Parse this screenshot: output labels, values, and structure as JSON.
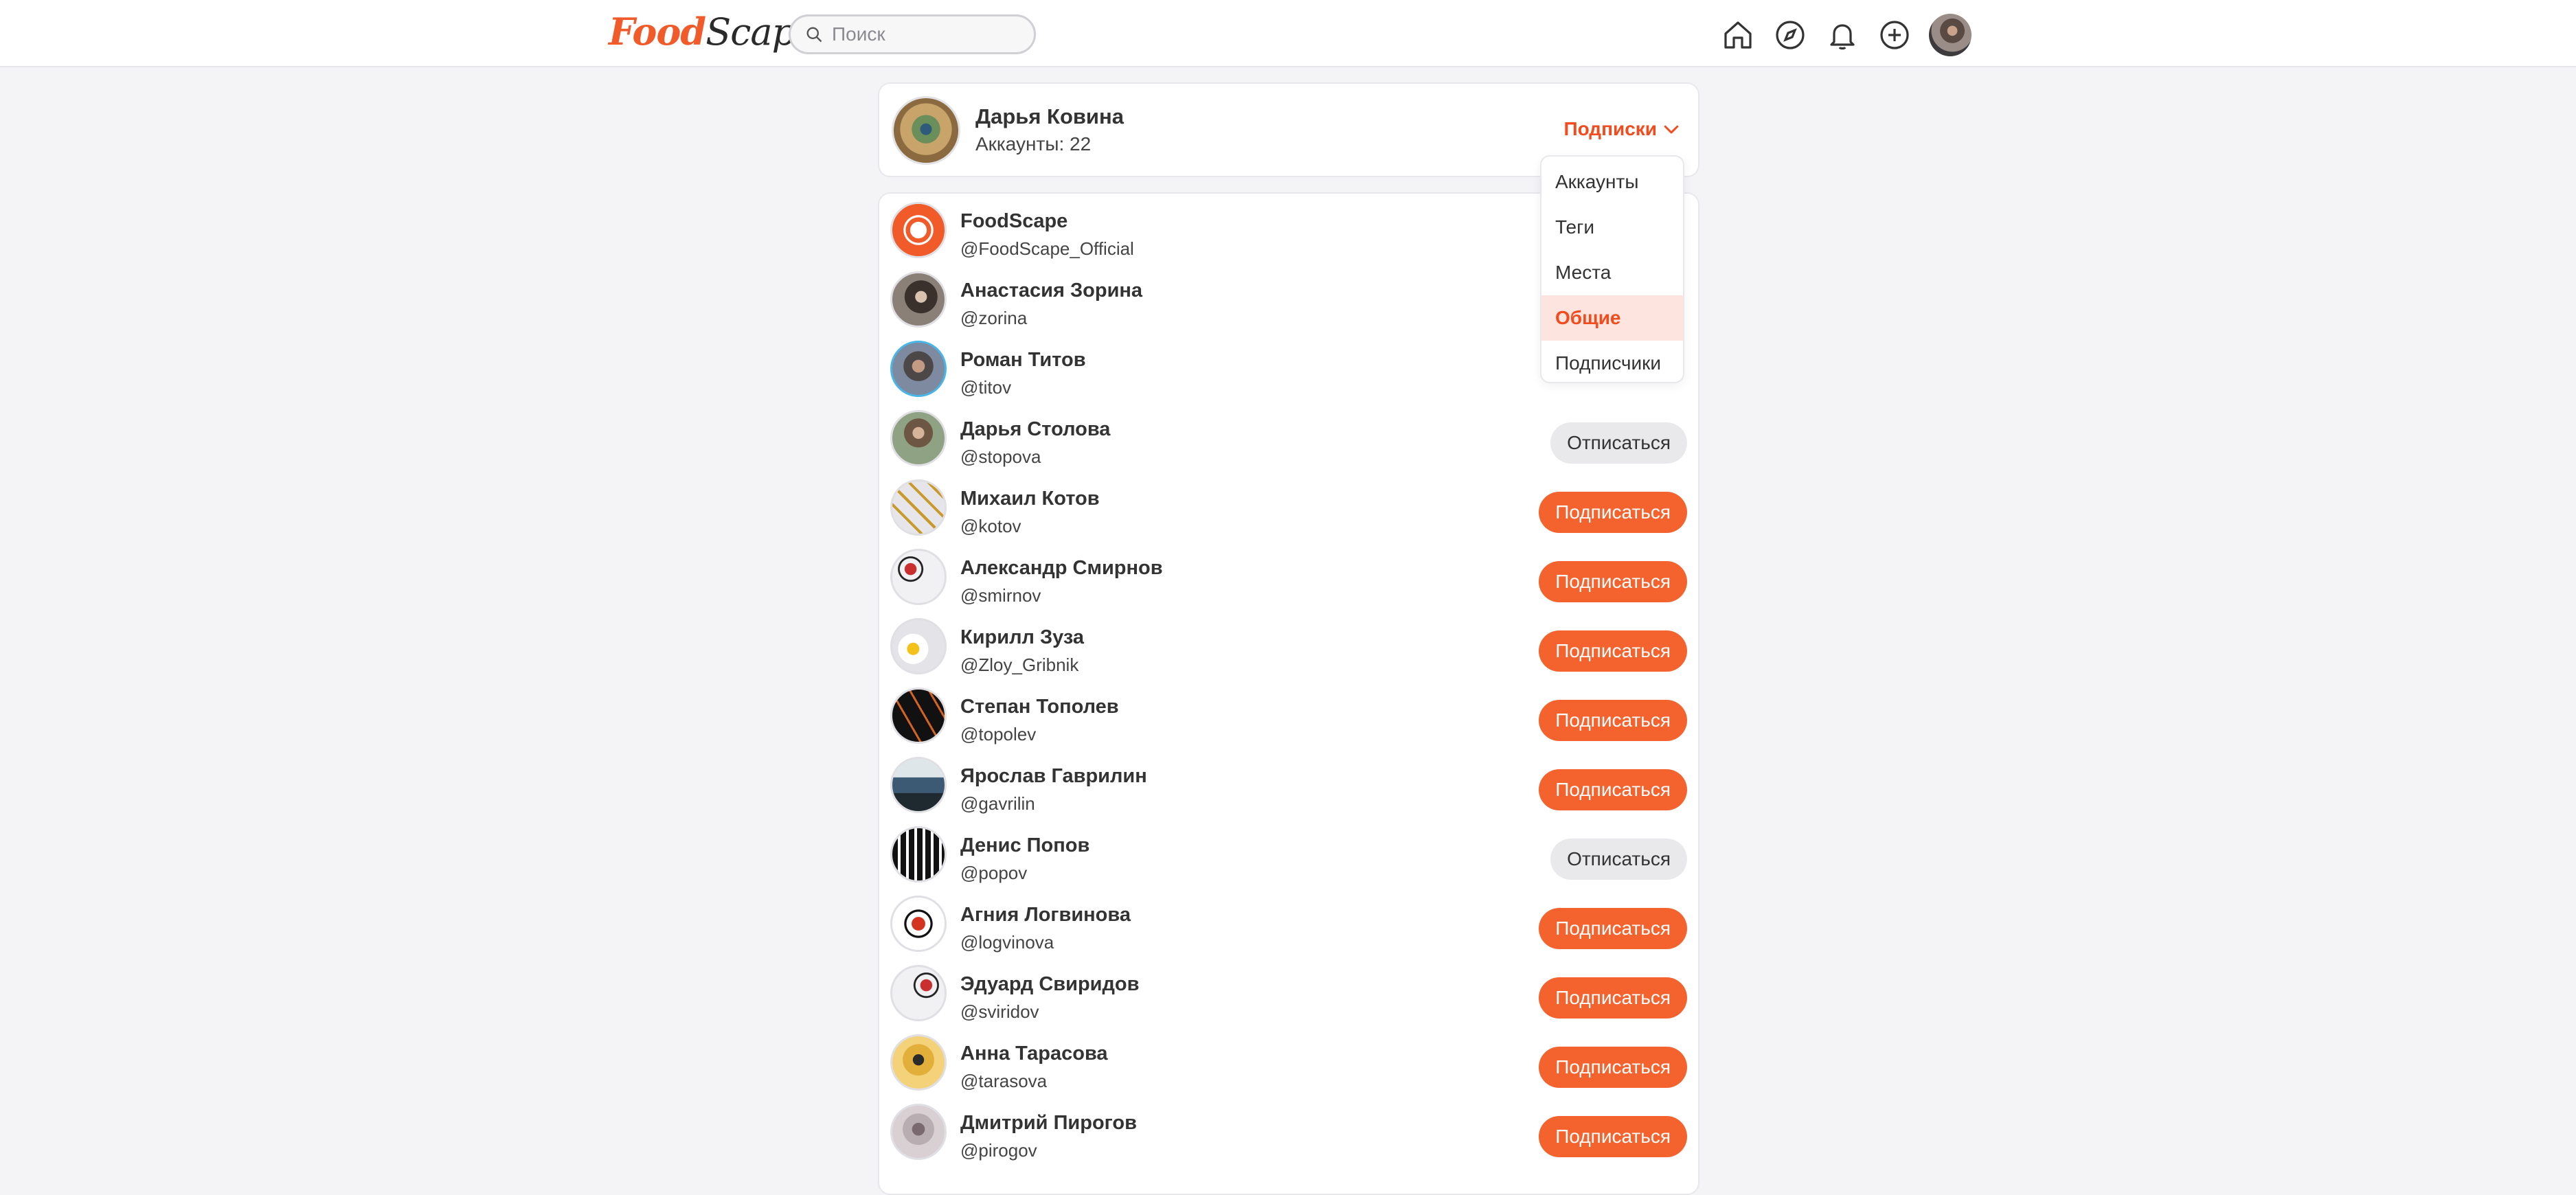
{
  "header": {
    "logo_food": "Food",
    "logo_scape": "Scape",
    "search_placeholder": "Поиск"
  },
  "profile": {
    "name": "Дарья Ковина",
    "accounts_count": "Аккаунты: 22",
    "filter_label": "Подписки"
  },
  "dropdown": {
    "items": [
      "Аккаунты",
      "Теги",
      "Места",
      "Общие",
      "Подписчики"
    ],
    "active": "Общие"
  },
  "accounts": [
    {
      "name": "FoodScape",
      "handle": "@FoodScape_Official",
      "button": ""
    },
    {
      "name": "Анастасия Зорина",
      "handle": "@zorina",
      "button": ""
    },
    {
      "name": "Роман Титов",
      "handle": "@titov",
      "button": ""
    },
    {
      "name": "Дарья Столова",
      "handle": "@stopova",
      "button": "Отписаться"
    },
    {
      "name": "Михаил Котов",
      "handle": "@kotov",
      "button": "Подписаться"
    },
    {
      "name": "Александр Смирнов",
      "handle": "@smirnov",
      "button": "Подписаться"
    },
    {
      "name": "Кирилл Зуза",
      "handle": "@Zloy_Gribnik",
      "button": "Подписаться"
    },
    {
      "name": "Степан Тополев",
      "handle": "@topolev",
      "button": "Подписаться"
    },
    {
      "name": "Ярослав Гаврилин",
      "handle": "@gavrilin",
      "button": "Подписаться"
    },
    {
      "name": "Денис Попов",
      "handle": "@popov",
      "button": "Отписаться"
    },
    {
      "name": "Агния Логвинова",
      "handle": "@logvinova",
      "button": "Подписаться"
    },
    {
      "name": "Эдуард Свиридов",
      "handle": "@sviridov",
      "button": "Подписаться"
    },
    {
      "name": "Анна Тарасова",
      "handle": "@tarasova",
      "button": "Подписаться"
    },
    {
      "name": "Дмитрий Пирогов",
      "handle": "@pirogov",
      "button": "Подписаться"
    }
  ],
  "colors": {
    "accent": "#f4622d",
    "accent_text": "#f14b1e",
    "background": "#f4f4f7"
  }
}
